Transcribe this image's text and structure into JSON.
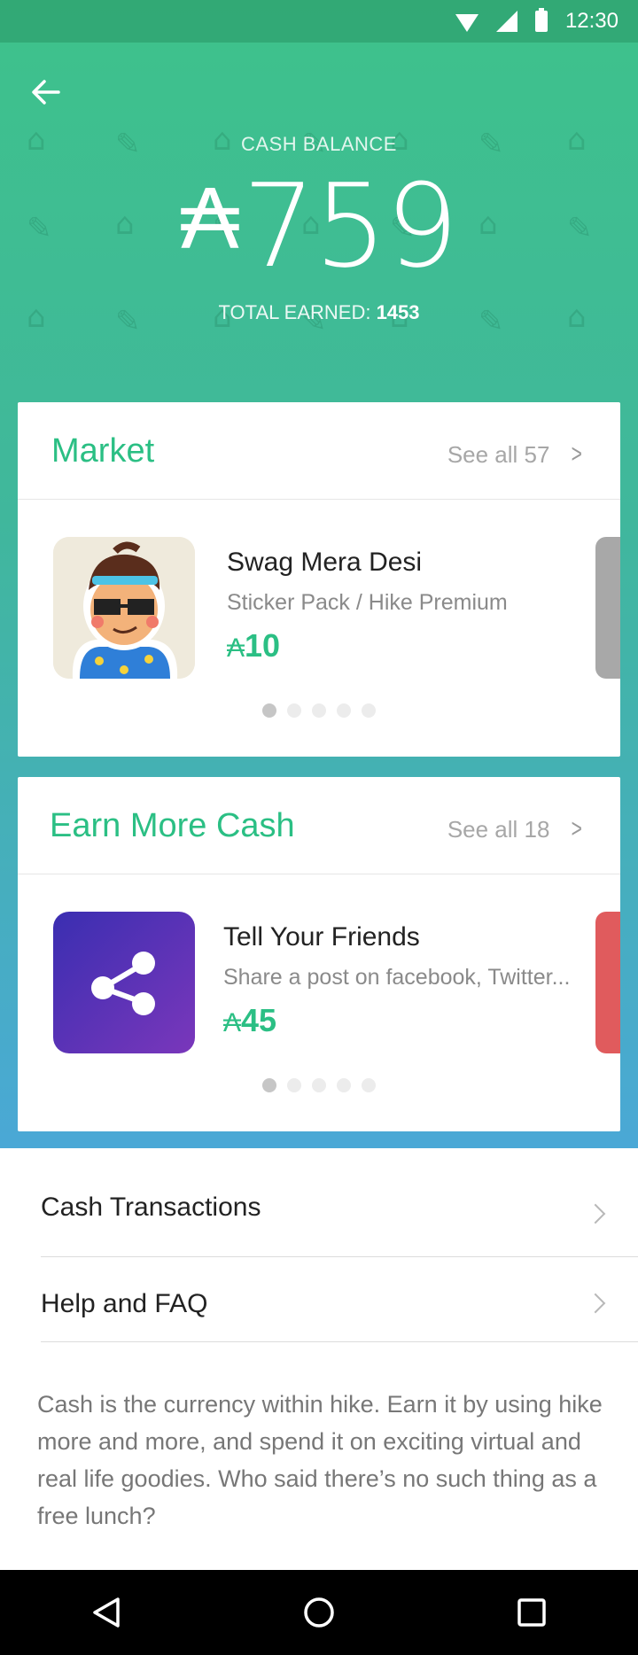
{
  "status_bar": {
    "time": "12:30"
  },
  "header": {
    "balance_label": "CASH BALANCE",
    "currency_symbol": "₳",
    "balance": "759",
    "total_earned_label": "TOTAL EARNED: ",
    "total_earned_value": "1453"
  },
  "market": {
    "title": "Market",
    "see_all": "See all 57",
    "item": {
      "title": "Swag Mera Desi",
      "subtitle": "Sticker Pack / Hike Premium",
      "price_symbol": "₳",
      "price": "10"
    },
    "dots": 5,
    "active_dot": 0
  },
  "earn": {
    "title": "Earn More Cash",
    "see_all": "See all 18",
    "item": {
      "title": "Tell Your Friends",
      "subtitle": "Share a post on facebook, Twitter...",
      "price_symbol": "₳",
      "price": "45"
    },
    "dots": 5,
    "active_dot": 0
  },
  "menu": {
    "items": [
      {
        "label": "Cash Transactions"
      },
      {
        "label": "Help and FAQ"
      }
    ]
  },
  "description": "Cash is the currency within hike. Earn it by using hike more and more, and spend it on exciting virtual and real life goodies. Who said there’s no such thing as a free lunch?",
  "icons": {
    "back": "back-arrow-icon",
    "share": "share-icon",
    "nav_back": "triangle-back-icon",
    "nav_home": "circle-home-icon",
    "nav_recents": "square-recents-icon"
  },
  "colors": {
    "accent": "#2bbf84",
    "hero_top": "#3ec28b",
    "hero_bottom": "#4aa8d6",
    "share_tile": "#3a2eb1",
    "peek_red": "#e05b5d"
  }
}
